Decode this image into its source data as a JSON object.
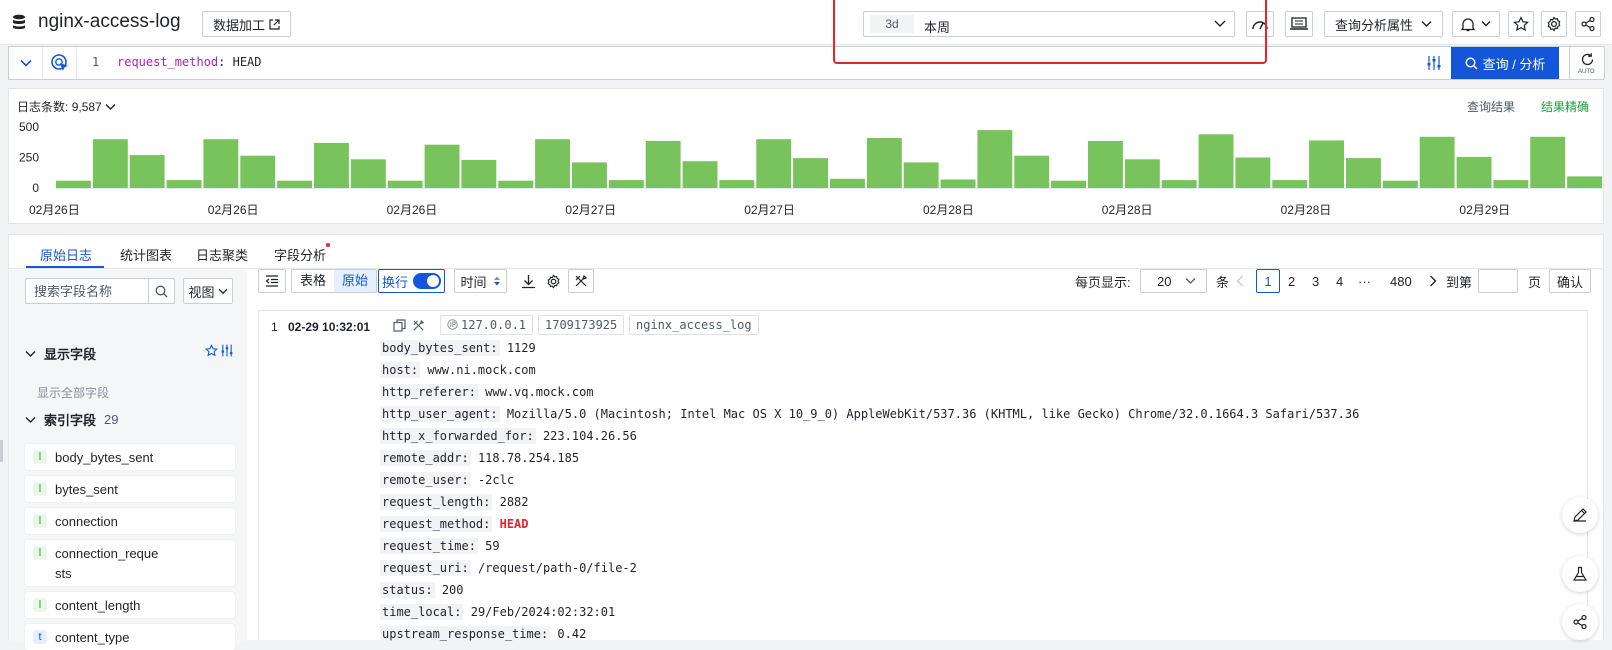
{
  "header": {
    "title": "nginx-access-log",
    "data_process_label": "数据加工",
    "time_tag": "3d",
    "time_value": "本周",
    "analysis_props_label": "查询分析属性"
  },
  "query": {
    "line_number": "1",
    "key": "request_method",
    "rest": ": HEAD",
    "search_label": "查询 / 分析",
    "auto_label": "AUTO"
  },
  "histogram": {
    "count_label": "日志条数:",
    "count_value": "9,587",
    "result_label": "查询结果",
    "accuracy_label": "结果精确"
  },
  "chart_data": {
    "type": "bar",
    "ylim": [
      0,
      500
    ],
    "y_ticks": [
      "0",
      "250",
      "500"
    ],
    "x_tick_labels": [
      "02月26日",
      "02月26日",
      "02月26日",
      "02月27日",
      "02月27日",
      "02月28日",
      "02月28日",
      "02月28日",
      "02月29日"
    ],
    "values": [
      60,
      400,
      270,
      65,
      400,
      265,
      60,
      370,
      235,
      60,
      355,
      230,
      60,
      400,
      210,
      65,
      385,
      220,
      65,
      400,
      245,
      75,
      410,
      210,
      70,
      475,
      265,
      60,
      385,
      235,
      65,
      440,
      250,
      65,
      390,
      245,
      60,
      420,
      255,
      65,
      420,
      95
    ],
    "color": "#79c35d"
  },
  "tabs": [
    {
      "label": "原始日志"
    },
    {
      "label": "统计图表"
    },
    {
      "label": "日志聚类"
    },
    {
      "label": "字段分析"
    }
  ],
  "sidebar": {
    "search_placeholder": "搜索字段名称",
    "view_label": "视图",
    "display_fields_label": "显示字段",
    "show_all_label": "显示全部字段",
    "index_fields_label": "索引字段",
    "index_fields_count": "29",
    "fields": [
      {
        "type": "l",
        "name": "body_bytes_sent"
      },
      {
        "type": "l",
        "name": "bytes_sent"
      },
      {
        "type": "l",
        "name": "connection"
      },
      {
        "type": "l",
        "name": "connection_reque",
        "name2": "sts"
      },
      {
        "type": "l",
        "name": "content_length"
      },
      {
        "type": "t",
        "name": "content_type"
      }
    ]
  },
  "toolbar": {
    "table_label": "表格",
    "raw_label": "原始",
    "wrap_label": "换行",
    "time_label": "时间"
  },
  "pager": {
    "per_page_label": "每页显示:",
    "per_page_value": "20",
    "unit_label": "条",
    "pages": [
      "1",
      "2",
      "3",
      "4",
      "···",
      "480"
    ],
    "goto_label": "到第",
    "page_label": "页",
    "confirm_label": "确认"
  },
  "log": {
    "index": "1",
    "time": "02-29 10:32:01",
    "tags": [
      "127.0.0.1",
      "1709173925",
      "nginx_access_log"
    ],
    "fields": [
      {
        "k": "body_bytes_sent:",
        "v": "1129"
      },
      {
        "k": "host:",
        "v": "www.ni.mock.com"
      },
      {
        "k": "http_referer:",
        "v": "www.vq.mock.com"
      },
      {
        "k": "http_user_agent:",
        "v": "Mozilla/5.0 (Macintosh; Intel Mac OS X 10_9_0) AppleWebKit/537.36 (KHTML, like Gecko) Chrome/32.0.1664.3 Safari/537.36"
      },
      {
        "k": "http_x_forwarded_for:",
        "v": "223.104.26.56"
      },
      {
        "k": "remote_addr:",
        "v": "118.78.254.185"
      },
      {
        "k": "remote_user:",
        "v": "-2clc"
      },
      {
        "k": "request_length:",
        "v": "2882"
      },
      {
        "k": "request_method:",
        "v": "HEAD"
      },
      {
        "k": "request_time:",
        "v": "59"
      },
      {
        "k": "request_uri:",
        "v": "/request/path-0/file-2"
      },
      {
        "k": "status:",
        "v": "200"
      },
      {
        "k": "time_local:",
        "v": "29/Feb/2024:02:32:01"
      },
      {
        "k": "upstream_response_time:",
        "v": "0.42"
      }
    ]
  },
  "colors": {
    "primary": "#1456d9",
    "highlight_box": "#e8242b",
    "bar": "#79c35d"
  }
}
